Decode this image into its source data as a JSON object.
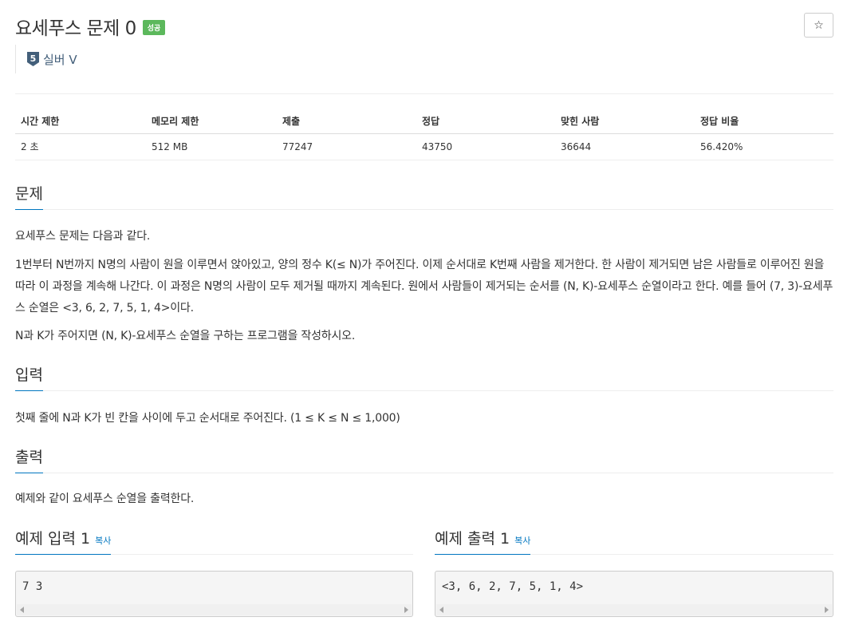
{
  "header": {
    "title": "요세푸스 문제 0",
    "status_badge": "성공",
    "star": "☆",
    "tier_icon": "silver-5-tier-icon",
    "tier_number": "5",
    "tier_label": "실버 V"
  },
  "info_table": {
    "headers": [
      "시간 제한",
      "메모리 제한",
      "제출",
      "정답",
      "맞힌 사람",
      "정답 비율"
    ],
    "values": [
      "2 초",
      "512 MB",
      "77247",
      "43750",
      "36644",
      "56.420%"
    ]
  },
  "sections": {
    "problem": {
      "heading": "문제",
      "paragraphs": [
        "요세푸스 문제는 다음과 같다.",
        "1번부터 N번까지 N명의 사람이 원을 이루면서 앉아있고, 양의 정수 K(≤ N)가 주어진다. 이제 순서대로 K번째 사람을 제거한다. 한 사람이 제거되면 남은 사람들로 이루어진 원을 따라 이 과정을 계속해 나간다. 이 과정은 N명의 사람이 모두 제거될 때까지 계속된다. 원에서 사람들이 제거되는 순서를 (N, K)-요세푸스 순열이라고 한다. 예를 들어 (7, 3)-요세푸스 순열은 <3, 6, 2, 7, 5, 1, 4>이다.",
        "N과 K가 주어지면 (N, K)-요세푸스 순열을 구하는 프로그램을 작성하시오."
      ]
    },
    "input": {
      "heading": "입력",
      "text": "첫째 줄에 N과 K가 빈 칸을 사이에 두고 순서대로 주어진다. (1 ≤ K ≤ N ≤ 1,000)"
    },
    "output": {
      "heading": "출력",
      "text": "예제와 같이 요세푸스 순열을 출력한다."
    }
  },
  "samples": {
    "input": {
      "heading": "예제 입력 1",
      "copy": "복사",
      "content": "7 3"
    },
    "output": {
      "heading": "예제 출력 1",
      "copy": "복사",
      "content": "<3, 6, 2, 7, 5, 1, 4>"
    }
  },
  "colors": {
    "badge_success": "#5cb85c",
    "tier_silver": "#435f7a",
    "link": "#0076c0"
  }
}
